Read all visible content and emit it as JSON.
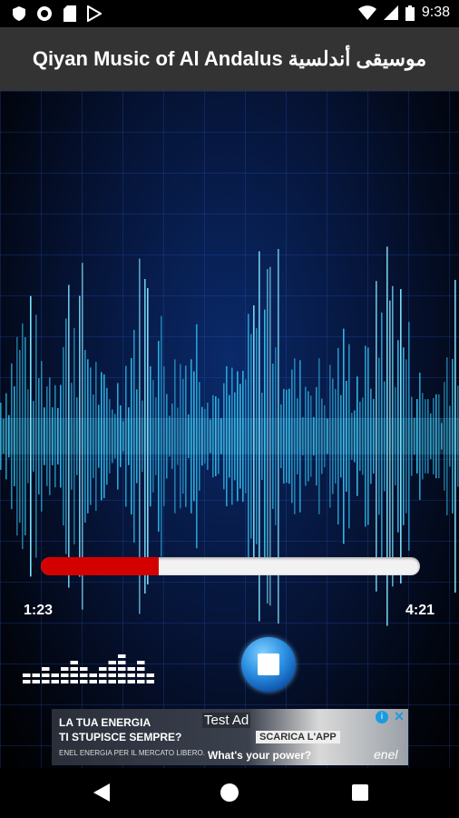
{
  "status_bar": {
    "time": "9:38",
    "icons": [
      "shield-icon",
      "circle-icon",
      "sd-card-icon",
      "play-store-icon",
      "wifi-icon",
      "signal-icon",
      "battery-icon"
    ]
  },
  "app": {
    "title": "Qiyan Music of Al Andalus موسيقى أندلسية"
  },
  "player": {
    "elapsed": "1:23",
    "duration": "4:21",
    "progress_fraction": 0.31,
    "progress_color": "#d40000",
    "stop_icon": "stop-icon",
    "equalizer_icon": "equalizer-icon"
  },
  "ad": {
    "line1": "LA TUA ENERGIA",
    "line2": "TI STUPISCE SEMPRE?",
    "small": "ENEL ENERGIA PER IL MERCATO LIBERO.",
    "badge": "Test Ad",
    "cta": "SCARICA L'APP",
    "tagline": "What's your power?",
    "brand": "enel",
    "info_icon": "info-icon",
    "close_icon": "close-icon"
  },
  "nav": {
    "back_icon": "back-icon",
    "home_icon": "home-icon",
    "recents_icon": "recents-icon"
  }
}
